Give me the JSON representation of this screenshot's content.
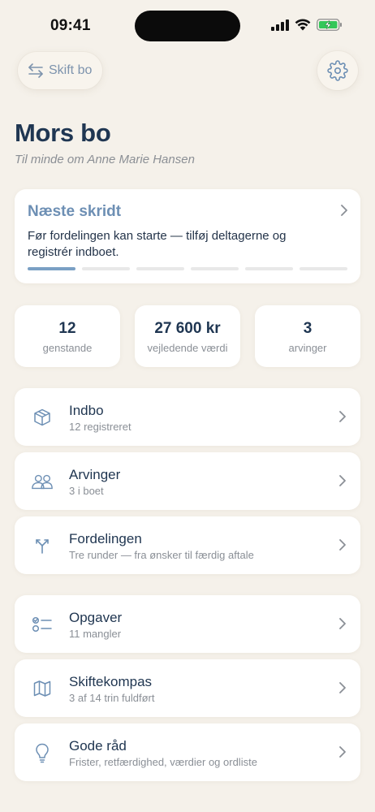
{
  "status_bar": {
    "time": "09:41",
    "icons": [
      "cellular-signal-icon",
      "wifi-icon",
      "battery-charging-icon"
    ]
  },
  "header": {
    "switch_label": "Skift bo",
    "switch_icon": "swap-arrows-icon",
    "settings_icon": "gear-icon"
  },
  "title": "Mors bo",
  "subtitle": "Til minde om Anne Marie Hansen",
  "next_step": {
    "title": "Næste skridt",
    "description": "Før fordelingen kan starte — tilføj deltagerne og registrér indboet.",
    "steps_total": 6,
    "steps_done": 1
  },
  "stats": [
    {
      "value": "12",
      "label": "genstande"
    },
    {
      "value": "27 600 kr",
      "label": "vejledende værdi"
    },
    {
      "value": "3",
      "label": "arvinger"
    }
  ],
  "menu": [
    {
      "icon": "box-icon",
      "title": "Indbo",
      "subtitle": "12 registreret"
    },
    {
      "icon": "people-icon",
      "title": "Arvinger",
      "subtitle": "3 i boet"
    },
    {
      "icon": "split-arrow-icon",
      "title": "Fordelingen",
      "subtitle": "Tre runder — fra ønsker til færdig aftale"
    },
    {
      "icon": "checklist-icon",
      "title": "Opgaver",
      "subtitle": "11 mangler"
    },
    {
      "icon": "map-icon",
      "title": "Skiftekompas",
      "subtitle": "3 af 14 trin fuldført"
    },
    {
      "icon": "lightbulb-icon",
      "title": "Gode råd",
      "subtitle": "Frister, retfærdighed, værdier og ordliste"
    }
  ],
  "colors": {
    "background": "#f5f1ea",
    "accent": "#6d8fb4",
    "title": "#1f3652",
    "muted": "#8a8f96",
    "battery_green": "#34c759"
  }
}
